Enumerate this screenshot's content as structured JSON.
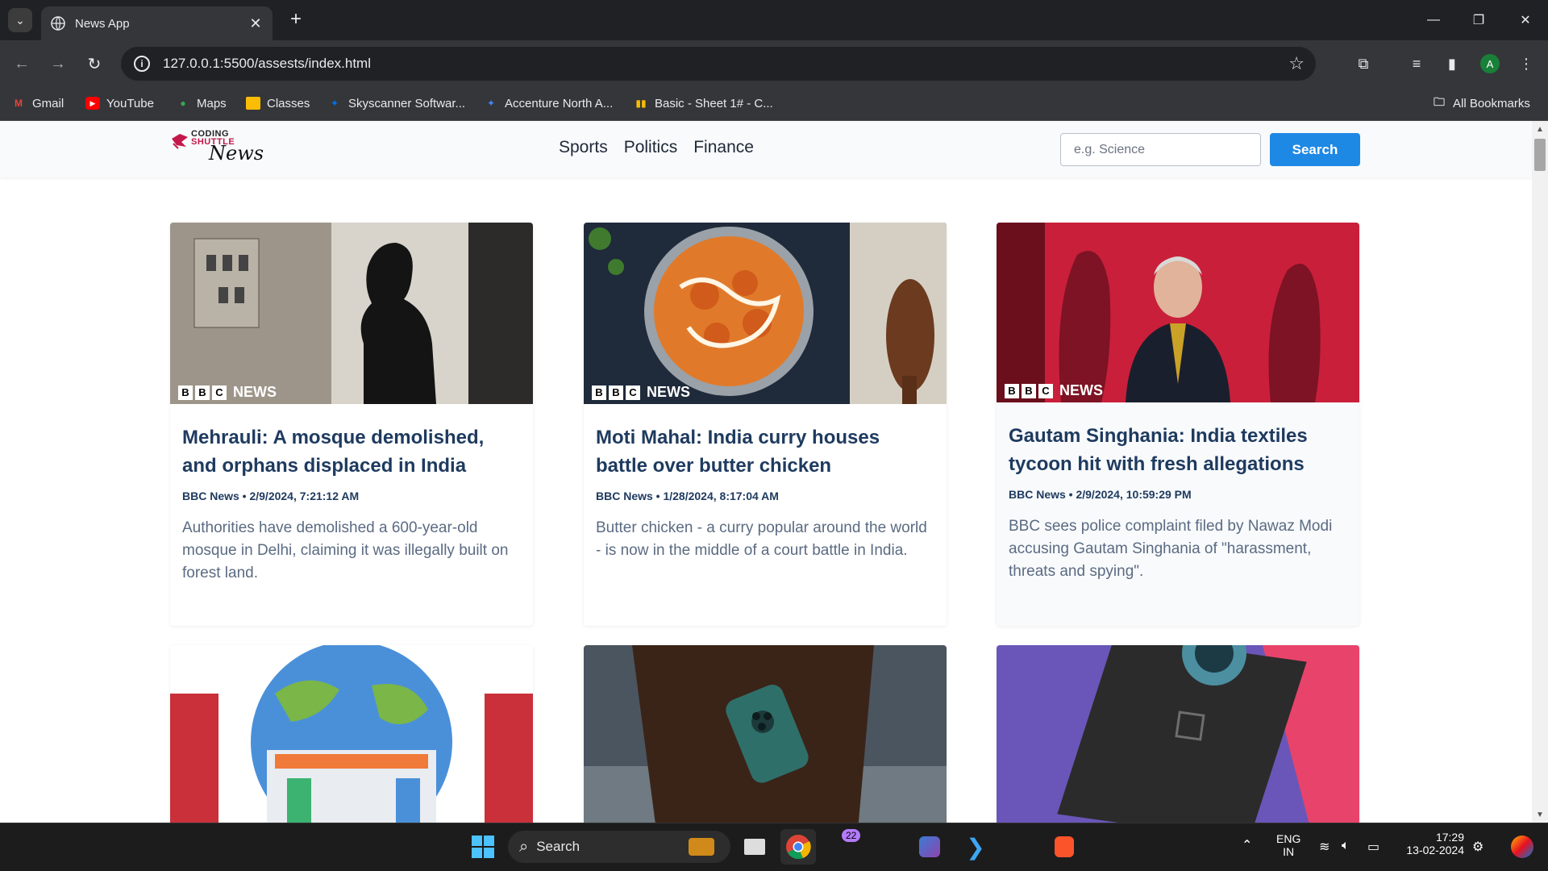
{
  "browser": {
    "tab_title": "News App",
    "url": "127.0.0.1:5500/assests/index.html",
    "avatar_letter": "A",
    "bookmarks": [
      {
        "label": "Gmail"
      },
      {
        "label": "YouTube"
      },
      {
        "label": "Maps"
      },
      {
        "label": "Classes"
      },
      {
        "label": "Skyscanner Softwar..."
      },
      {
        "label": "Accenture North A..."
      },
      {
        "label": "Basic - Sheet 1# - C..."
      }
    ],
    "all_bookmarks": "All Bookmarks"
  },
  "site": {
    "logo_line1": "CODING",
    "logo_line2": "SHUTTLE",
    "logo_line3": "News",
    "nav": [
      "Sports",
      "Politics",
      "Finance"
    ],
    "search_placeholder": "e.g. Science",
    "search_button": "Search"
  },
  "cards": [
    {
      "source_badge": "NEWS",
      "title": "Mehrauli: A mosque demolished, and orphans displaced in India",
      "meta": "BBC News • 2/9/2024, 7:21:12 AM",
      "description": "Authorities have demolished a 600-year-old mosque in Delhi, claiming it was illegally built on forest land."
    },
    {
      "source_badge": "NEWS",
      "title": "Moti Mahal: India curry houses battle over butter chicken",
      "meta": "BBC News • 1/28/2024, 8:17:04 AM",
      "description": "Butter chicken - a curry popular around the world - is now in the middle of a court battle in India."
    },
    {
      "source_badge": "NEWS",
      "title": "Gautam Singhania: India textiles tycoon hit with fresh allegations",
      "meta": "BBC News • 2/9/2024, 10:59:29 PM",
      "description": "BBC sees police complaint filed by Nawaz Modi accusing Gautam Singhania of \"harassment, threats and spying\"."
    }
  ],
  "taskbar": {
    "search_label": "Search",
    "notification_count": "22",
    "lang_line1": "ENG",
    "lang_line2": "IN",
    "time": "17:29",
    "date": "13-02-2024"
  },
  "colors": {
    "accent": "#1e88e5",
    "card_title": "#1e3a5f",
    "card_desc": "#5b6b82",
    "header_bg": "#f8fafc"
  }
}
